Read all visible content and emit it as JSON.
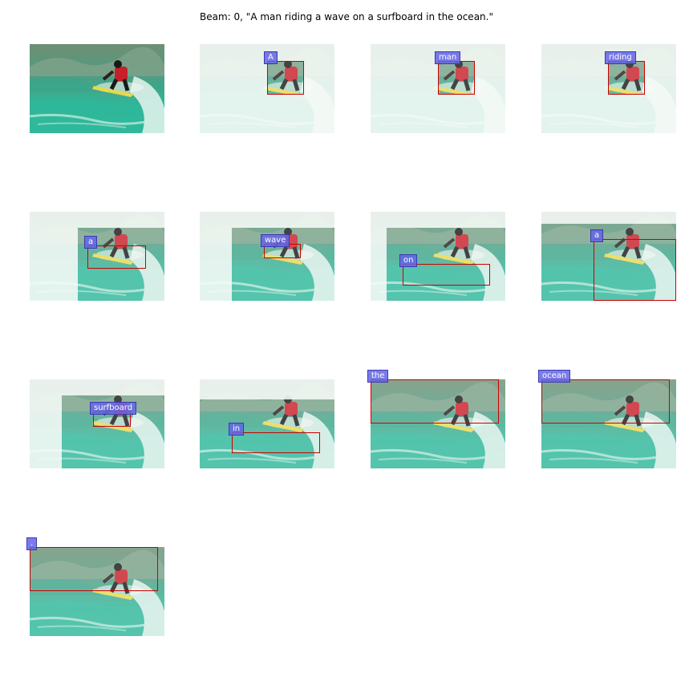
{
  "title": "Beam: 0, \"A man riding a wave on a surfboard in the ocean.\"",
  "panels": [
    {
      "word": ""
    },
    {
      "word": "A"
    },
    {
      "word": "man"
    },
    {
      "word": "riding"
    },
    {
      "word": "a"
    },
    {
      "word": "wave"
    },
    {
      "word": "on"
    },
    {
      "word": "a"
    },
    {
      "word": "surfboard"
    },
    {
      "word": "in"
    },
    {
      "word": "the"
    },
    {
      "word": "ocean"
    },
    {
      "word": "."
    }
  ],
  "colors": {
    "box_stroke": "#cc0000",
    "label_fill": "#6464e6",
    "water": "#2fb79a",
    "wetsuit": "#c8202a",
    "surfboard": "#e8d84a"
  }
}
